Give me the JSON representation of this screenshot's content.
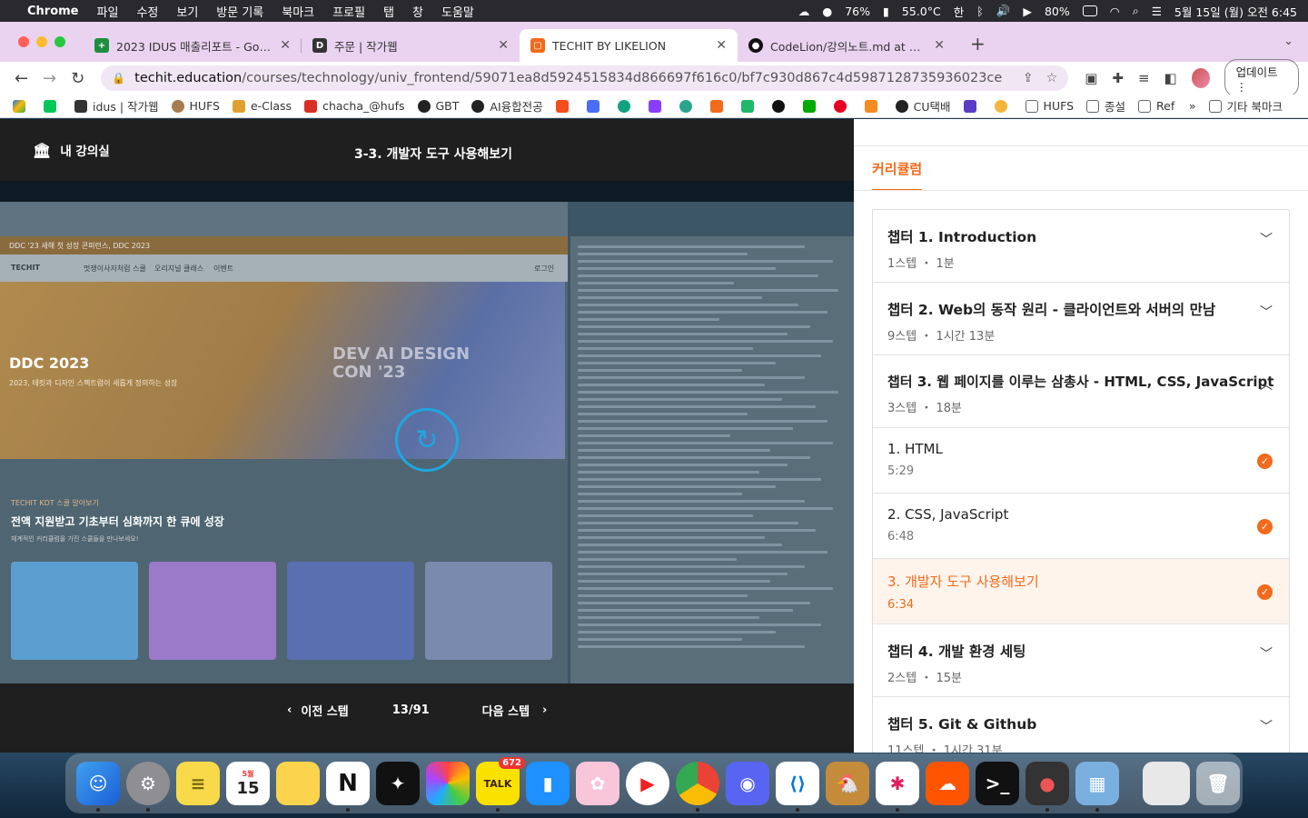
{
  "menubar": {
    "app": "Chrome",
    "menus": [
      "파일",
      "수정",
      "보기",
      "방문 기록",
      "북마크",
      "프로필",
      "탭",
      "창",
      "도움말"
    ],
    "battery_bar": "76%",
    "temperature": "55.0°C",
    "battery": "80%",
    "input_method": "한",
    "datetime": "5월 15일 (월) 오전 6:45"
  },
  "tabs": [
    {
      "title": "2023 IDUS 매출리포트 - Google 스",
      "favicon_color": "#1e8e3e",
      "favicon_letter": "+"
    },
    {
      "title": "주문 | 작가웹",
      "favicon_color": "#333333",
      "favicon_letter": "D"
    },
    {
      "title": "TECHIT BY LIKELION",
      "favicon_color": "#f26a1b",
      "favicon_letter": "▢"
    },
    {
      "title": "CodeLion/강의노트.md at main · C",
      "favicon_color": "#111111",
      "favicon_letter": "●"
    }
  ],
  "address": {
    "domain": "techit.education",
    "path": "/courses/technology/univ_frontend/59071ea8d5924515834d866697f616c0/bf7c930d867c4d5987128735936023ce",
    "update_label": "업데이트"
  },
  "bookmarks": [
    "idus | 작가웹",
    "HUFS",
    "e-Class",
    "chacha_@hufs",
    "GBT",
    "AI융합전공",
    "CU택배",
    "HUFS",
    "종설",
    "Ref"
  ],
  "bookmarks_other": "기타 북마크",
  "player": {
    "my_class": "내 강의실",
    "lesson_title": "3-3. 개발자 도구 사용해보기",
    "prev_label": "이전 스텝",
    "next_label": "다음 스텝",
    "counter": "13/91"
  },
  "video": {
    "banner": "DDC '23 새해 첫 성장 콘퍼런스, DDC 2023",
    "nav_logo": "TECHIT",
    "nav_items": [
      "멋쟁이사자처럼 스쿨",
      "오리지널 클래스",
      "이벤트"
    ],
    "nav_login": "로그인",
    "hero_title": "DDC 2023",
    "hero_sub": "2023, 테킷과 디자인 스펙트럼이 새롭게 정의하는 성장",
    "hero_overlay": "DEV AI DESIGN CON '23",
    "section_kicker": "TECHIT KDT 스쿨 알아보기",
    "section_title": "전액 지원받고 기초부터 심화까지 한 큐에 성장",
    "section_desc": "체계적인 커리큘럼을 가진 스쿨들을 만나보세요!"
  },
  "sidebar": {
    "tab_label": "커리큘럼",
    "chapters_before": [
      {
        "title": "챕터 1. Introduction",
        "meta": "1스텝 ・ 1분"
      },
      {
        "title": "챕터 2. Web의 동작 원리 - 클라이언트와 서버의 만남",
        "meta": "9스텝 ・ 1시간 13분"
      },
      {
        "title": "챕터 3. 웹 페이지를 이루는 삼총사 - HTML, CSS, JavaScript",
        "meta": "3스텝 ・ 18분"
      }
    ],
    "steps": [
      {
        "title": "1. HTML",
        "time": "5:29"
      },
      {
        "title": "2. CSS, JavaScript",
        "time": "6:48"
      },
      {
        "title": "3. 개발자 도구 사용해보기",
        "time": "6:34"
      }
    ],
    "chapters_after": [
      {
        "title": "챕터 4. 개발 환경 세팅",
        "meta": "2스텝 ・ 15분"
      },
      {
        "title": "챕터 5. Git & Github",
        "meta": "11스텝 ・ 1시간 31분"
      }
    ]
  },
  "dock": {
    "calendar_month": "5월",
    "calendar_day": "15",
    "kakaotalk_badge": "672",
    "kakaotalk_label": "TALK",
    "notion_label": "N"
  }
}
